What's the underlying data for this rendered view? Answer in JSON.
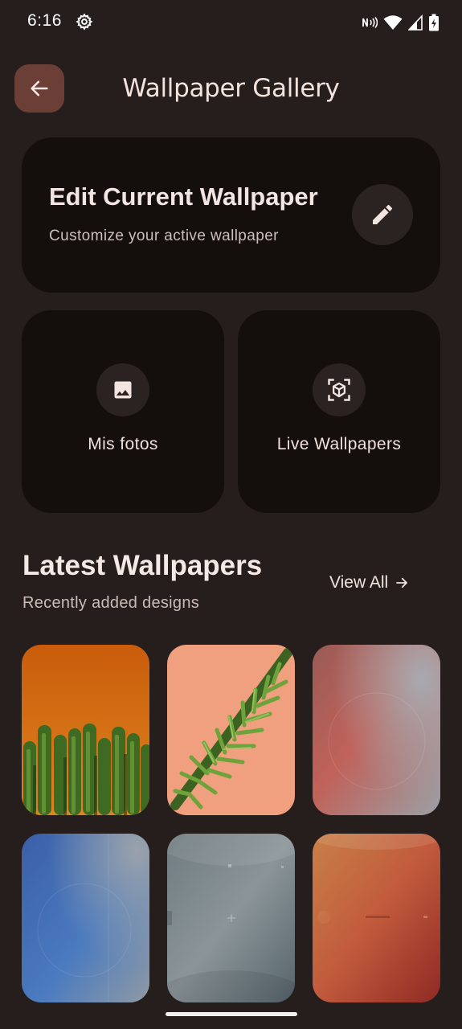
{
  "status_bar": {
    "time": "6:16",
    "icons": [
      "settings-icon",
      "nfc-icon",
      "wifi-icon",
      "signal-icon",
      "battery-charging-icon"
    ]
  },
  "app_bar": {
    "title": "Wallpaper Gallery",
    "back_icon": "arrow-back-icon"
  },
  "edit_card": {
    "title": "Edit Current Wallpaper",
    "subtitle": "Customize your active wallpaper",
    "icon": "edit-pencil-icon"
  },
  "tiles": [
    {
      "label": "Mis fotos",
      "icon": "image-icon"
    },
    {
      "label": "Live Wallpapers",
      "icon": "3d-cube-icon"
    }
  ],
  "latest": {
    "title": "Latest Wallpapers",
    "subtitle": "Recently added designs",
    "view_all": "View All",
    "view_all_icon": "arrow-forward-icon",
    "items": [
      {
        "name": "cactus-orange"
      },
      {
        "name": "fern-peach"
      },
      {
        "name": "gradient-rose-grey"
      },
      {
        "name": "gradient-blue"
      },
      {
        "name": "gradient-slate"
      },
      {
        "name": "gradient-orange-red"
      }
    ]
  },
  "colors": {
    "background": "#261e1c",
    "card": "#140e0d",
    "back_button": "#6b3f36",
    "icon_circle": "#2b2321",
    "text": "#f1e4e0"
  }
}
